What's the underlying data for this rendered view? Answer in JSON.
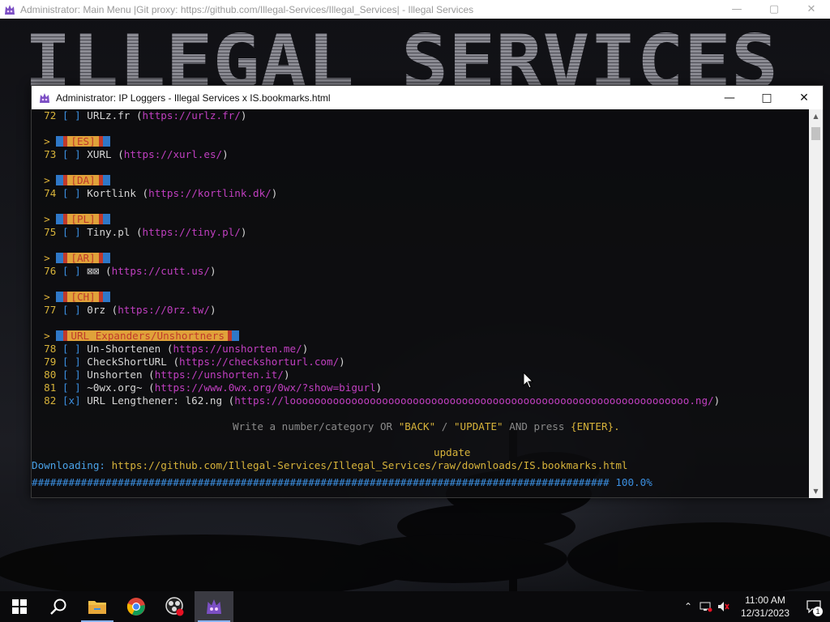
{
  "background_window": {
    "title": "Administrator:  Main Menu |Git proxy: https://github.com/Illegal-Services/Illegal_Services| - Illegal Services",
    "banner_text": "ILLEGAL SERVICES"
  },
  "window": {
    "title": "Administrator:  IP Loggers - Illegal Services x IS.bookmarks.html"
  },
  "console": {
    "chevron": ">",
    "entries": [
      {
        "num": "72",
        "check": "[ ]",
        "name": "URLz.fr",
        "url": "https://urlz.fr/"
      },
      {
        "tag": "[ES]"
      },
      {
        "num": "73",
        "check": "[ ]",
        "name": "XURL",
        "url": "https://xurl.es/"
      },
      {
        "tag": "[DA]"
      },
      {
        "num": "74",
        "check": "[ ]",
        "name": "Kortlink",
        "url": "https://kortlink.dk/"
      },
      {
        "tag": "[PL]"
      },
      {
        "num": "75",
        "check": "[ ]",
        "name": "Tiny.pl",
        "url": "https://tiny.pl/"
      },
      {
        "tag": "[AR]"
      },
      {
        "num": "76",
        "check": "[ ]",
        "name": "⊠⊠",
        "url": "https://cutt.us/"
      },
      {
        "tag": "[CH]"
      },
      {
        "num": "77",
        "check": "[ ]",
        "name": "0rz",
        "url": "https://0rz.tw/"
      },
      {
        "tag": "URL Expanders/Unshortners"
      },
      {
        "num": "78",
        "check": "[ ]",
        "name": "Un-Shortenen",
        "url": "https://unshorten.me/"
      },
      {
        "num": "79",
        "check": "[ ]",
        "name": "CheckShortURL",
        "url": "https://checkshorturl.com/"
      },
      {
        "num": "80",
        "check": "[ ]",
        "name": "Unshorten",
        "url": "https://unshorten.it/"
      },
      {
        "num": "81",
        "check": "[ ]",
        "name": "~0wx.org~",
        "url": "https://www.0wx.org/0wx/?show=bigurl"
      },
      {
        "num": "82",
        "check": "[x]",
        "name": "URL Lengthener: l62.ng",
        "url": "https://looooooooooooooooooooooooooooooooooooooooooooooooooooooooooooooooo.ng/"
      }
    ],
    "prompt": {
      "pre": "Write a number/category OR ",
      "back": "\"BACK\"",
      "sep": " / ",
      "update": "\"UPDATE\"",
      "mid": " AND press ",
      "enter": "{ENTER}."
    },
    "input": "update",
    "download_label": "Downloading:",
    "download_url": "https://github.com/Illegal-Services/Illegal_Services/raw/downloads/IS.bookmarks.html",
    "progress_bar": "##############################################################################################",
    "progress_value": "100.0%"
  },
  "taskbar": {
    "apps": [
      "windows-start",
      "search",
      "file-explorer",
      "chrome",
      "obs-studio",
      "illegal-services"
    ],
    "time": "11:00 AM",
    "date": "12/31/2023",
    "notification_count": "1"
  },
  "colors": {
    "number": "#d7b33a",
    "bracket": "#3b8fe0",
    "url": "#c03fc0",
    "tag_fill": "#e0a23a",
    "tag_text": "#c0392b"
  }
}
